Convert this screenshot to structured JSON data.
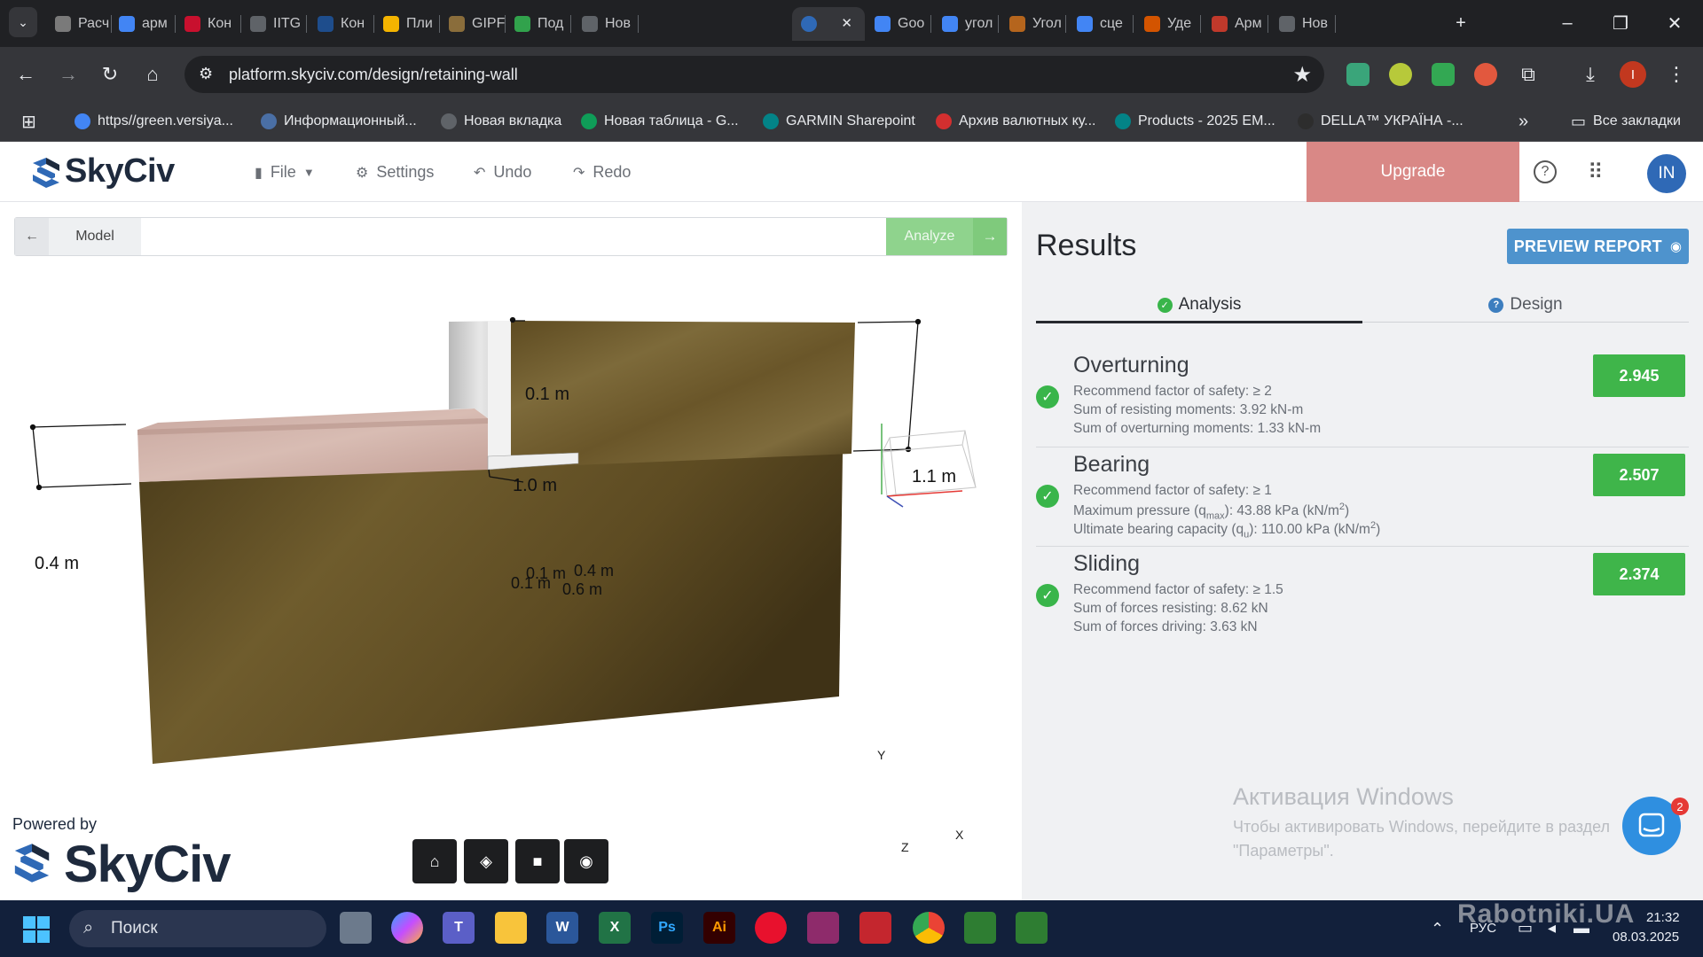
{
  "browser": {
    "tabs": [
      {
        "label": "Расч",
        "color": "#7a7a7a"
      },
      {
        "label": "арм",
        "color": "#4285f4"
      },
      {
        "label": "Кон",
        "color": "#c8102e"
      },
      {
        "label": "IITG",
        "color": "#5f6368"
      },
      {
        "label": "Кон",
        "color": "#1e4d8c"
      },
      {
        "label": "Пли",
        "color": "#f4b400"
      },
      {
        "label": "GIPF",
        "color": "#8a6d3b"
      },
      {
        "label": "Под",
        "color": "#31a24c"
      },
      {
        "label": "Нов",
        "color": "#5f6368"
      },
      {
        "label": "",
        "color": "#2f69b6"
      },
      {
        "label": "Goo",
        "color": "#4285f4"
      },
      {
        "label": "угол",
        "color": "#4285f4"
      },
      {
        "label": "Угол",
        "color": "#b5651d"
      },
      {
        "label": "сце",
        "color": "#4285f4"
      },
      {
        "label": "Уде",
        "color": "#d35400"
      },
      {
        "label": "Арм",
        "color": "#c0392b"
      },
      {
        "label": "Нов",
        "color": "#5f6368"
      }
    ],
    "url": "platform.skyciv.com/design/retaining-wall",
    "bookmarks": [
      {
        "label": "https//green.versiya...",
        "color": "#4285f4"
      },
      {
        "label": "Информационный...",
        "color": "#4a6fa5"
      },
      {
        "label": "Новая вкладка",
        "color": "#5f6368"
      },
      {
        "label": "Новая таблица - G...",
        "color": "#0f9d58"
      },
      {
        "label": "GARMIN Sharepoint",
        "color": "#038387"
      },
      {
        "label": "Архив валютных ку...",
        "color": "#d32f2f"
      },
      {
        "label": "Products - 2025 EM...",
        "color": "#038387"
      },
      {
        "label": "DELLA™ УКРАЇНА -...",
        "color": "#2d2d2d"
      }
    ],
    "all_bookmarks": "Все закладки",
    "more": "»"
  },
  "app": {
    "brand": "SkyCiv",
    "menu": {
      "file": "File",
      "settings": "Settings",
      "undo": "Undo",
      "redo": "Redo"
    },
    "upgrade": "Upgrade",
    "avatar": "IN",
    "accent": "#2f69b6"
  },
  "model": {
    "tab_label": "Model",
    "analyze_label": "Analyze",
    "dimensions": {
      "stem_thickness": "0.1 m",
      "stem_height": "1.0 m",
      "backfill_height": "1.1 m",
      "front_fill": "0.4 m",
      "toe": "0.1 m",
      "heel": "0.4 m",
      "base_thickness": "0.1 m",
      "base_width": "0.6 m"
    },
    "axes": {
      "x": "X",
      "y": "Y",
      "z": "Z"
    },
    "powered_by": "Powered by",
    "powered_brand": "SkyCiv",
    "view_buttons": [
      "home-icon",
      "cube-icon",
      "camera-icon",
      "eye-icon"
    ]
  },
  "results": {
    "title": "Results",
    "preview_report": "PREVIEW REPORT",
    "tabs": {
      "analysis": "Analysis",
      "design": "Design"
    },
    "cards": [
      {
        "title": "Overturning",
        "value": "2.945",
        "lines": [
          "Recommend factor of safety: ≥ 2",
          "Sum of resisting moments: 3.92 kN-m",
          "Sum of overturning moments: 1.33 kN-m"
        ]
      },
      {
        "title": "Bearing",
        "value": "2.507",
        "line1": "Recommend factor of safety: ≥ 1",
        "line2_pre": "Maximum pressure (q",
        "line2_sub": "max",
        "line2_post": "): 43.88 kPa (kN/m",
        "line2_sup": "2",
        "line2_end": ")",
        "line3_pre": "Ultimate bearing capacity (q",
        "line3_sub": "u",
        "line3_post": "): 110.00 kPa (kN/m",
        "line3_sup": "2",
        "line3_end": ")"
      },
      {
        "title": "Sliding",
        "value": "2.374",
        "lines": [
          "Recommend factor of safety: ≥ 1.5",
          "Sum of forces resisting: 8.62 kN",
          "Sum of forces driving: 3.63 kN"
        ]
      }
    ],
    "pass_color": "#3fb54a",
    "chat_badge": "2"
  },
  "windows": {
    "activation_title": "Активация Windows",
    "activation_body": "Чтобы активировать Windows, перейдите в раздел \"Параметры\".",
    "search": "Поиск",
    "lang": "РУС",
    "time": "21:32",
    "date": "08.03.2025",
    "site_watermark": "Rabotniki.UA"
  }
}
